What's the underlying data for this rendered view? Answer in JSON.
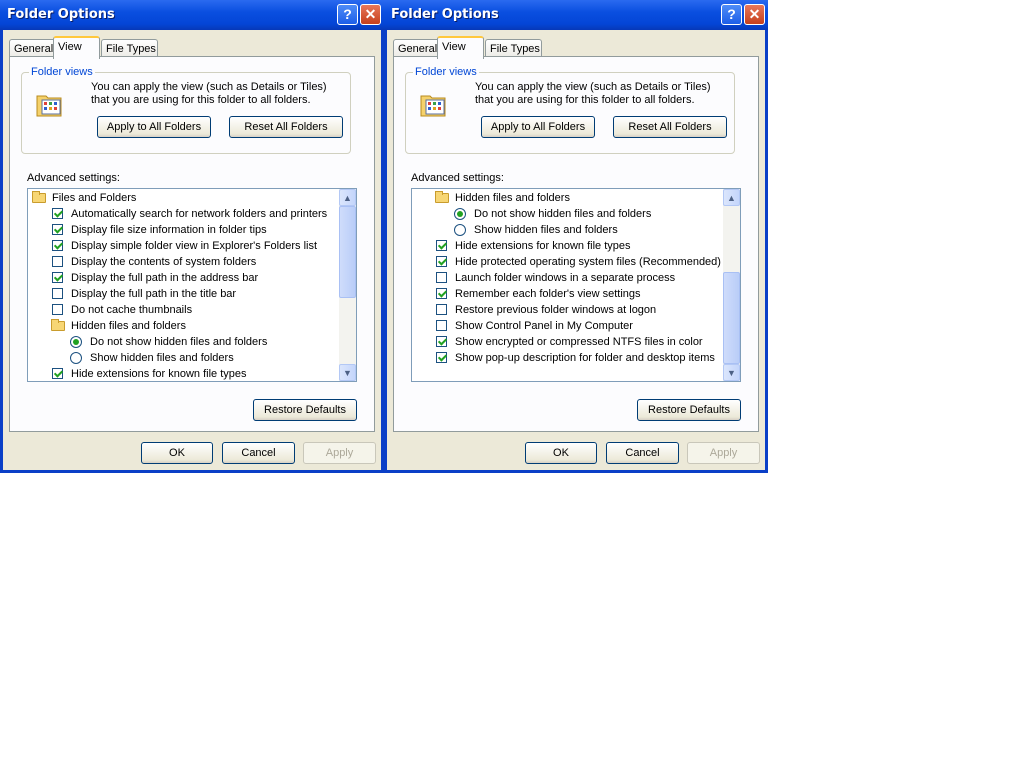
{
  "windows": [
    {
      "title": "Folder Options",
      "tabs": [
        "General",
        "View",
        "File Types"
      ],
      "folder_views": {
        "label": "Folder views",
        "text": "You can apply the view (such as Details or Tiles) that you are using for this folder to all folders.",
        "apply_all": "Apply to All Folders",
        "reset_all": "Reset All Folders"
      },
      "advanced_label": "Advanced settings:",
      "items": [
        {
          "type": "folder",
          "label": "Files and Folders",
          "indent": 0
        },
        {
          "type": "check",
          "label": "Automatically search for network folders and printers",
          "checked": true,
          "indent": 1
        },
        {
          "type": "check",
          "label": "Display file size information in folder tips",
          "checked": true,
          "indent": 1
        },
        {
          "type": "check",
          "label": "Display simple folder view in Explorer's Folders list",
          "checked": true,
          "indent": 1
        },
        {
          "type": "check",
          "label": "Display the contents of system folders",
          "checked": false,
          "indent": 1
        },
        {
          "type": "check",
          "label": "Display the full path in the address bar",
          "checked": true,
          "indent": 1
        },
        {
          "type": "check",
          "label": "Display the full path in the title bar",
          "checked": false,
          "indent": 1
        },
        {
          "type": "check",
          "label": "Do not cache thumbnails",
          "checked": false,
          "indent": 1
        },
        {
          "type": "folder",
          "label": "Hidden files and folders",
          "indent": 1
        },
        {
          "type": "radio",
          "label": "Do not show hidden files and folders",
          "checked": true,
          "indent": 2
        },
        {
          "type": "radio",
          "label": "Show hidden files and folders",
          "checked": false,
          "indent": 2
        },
        {
          "type": "check",
          "label": "Hide extensions for known file types",
          "checked": true,
          "indent": 1
        }
      ],
      "scroll_position": "top",
      "restore": "Restore Defaults",
      "ok": "OK",
      "cancel": "Cancel",
      "apply": "Apply"
    },
    {
      "title": "Folder Options",
      "tabs": [
        "General",
        "View",
        "File Types"
      ],
      "folder_views": {
        "label": "Folder views",
        "text": "You can apply the view (such as Details or Tiles) that you are using for this folder to all folders.",
        "apply_all": "Apply to All Folders",
        "reset_all": "Reset All Folders"
      },
      "advanced_label": "Advanced settings:",
      "items": [
        {
          "type": "folder",
          "label": "Hidden files and folders",
          "indent": 1
        },
        {
          "type": "radio",
          "label": "Do not show hidden files and folders",
          "checked": true,
          "indent": 2
        },
        {
          "type": "radio",
          "label": "Show hidden files and folders",
          "checked": false,
          "indent": 2
        },
        {
          "type": "check",
          "label": "Hide extensions for known file types",
          "checked": true,
          "indent": 1
        },
        {
          "type": "check",
          "label": "Hide protected operating system files (Recommended)",
          "checked": true,
          "indent": 1
        },
        {
          "type": "check",
          "label": "Launch folder windows in a separate process",
          "checked": false,
          "indent": 1
        },
        {
          "type": "check",
          "label": "Remember each folder's view settings",
          "checked": true,
          "indent": 1
        },
        {
          "type": "check",
          "label": "Restore previous folder windows at logon",
          "checked": false,
          "indent": 1
        },
        {
          "type": "check",
          "label": "Show Control Panel in My Computer",
          "checked": false,
          "indent": 1
        },
        {
          "type": "check",
          "label": "Show encrypted or compressed NTFS files in color",
          "checked": true,
          "indent": 1
        },
        {
          "type": "check",
          "label": "Show pop-up description for folder and desktop items",
          "checked": true,
          "indent": 1
        }
      ],
      "scroll_position": "bottom",
      "restore": "Restore Defaults",
      "ok": "OK",
      "cancel": "Cancel",
      "apply": "Apply"
    }
  ]
}
